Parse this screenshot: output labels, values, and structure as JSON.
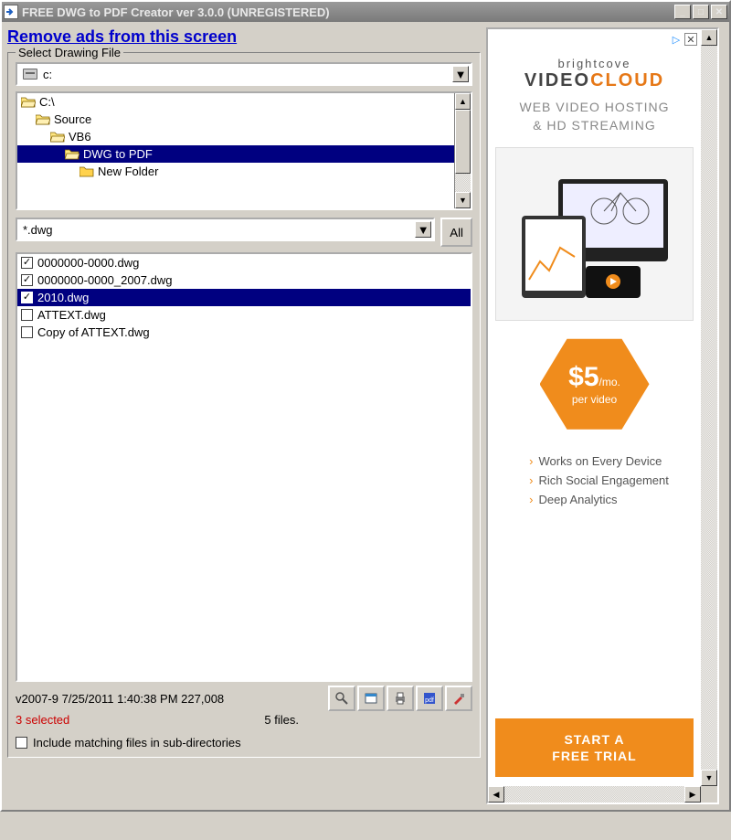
{
  "titlebar": {
    "title": "FREE DWG to PDF Creator ver 3.0.0 (UNREGISTERED)"
  },
  "ads_link": "Remove ads from this screen",
  "group": {
    "title": "Select Drawing File",
    "drive_combo": "c:",
    "tree": [
      {
        "label": "C:\\",
        "indent": 0,
        "open": true,
        "sel": false
      },
      {
        "label": "Source",
        "indent": 1,
        "open": true,
        "sel": false
      },
      {
        "label": "VB6",
        "indent": 2,
        "open": true,
        "sel": false
      },
      {
        "label": "DWG to PDF",
        "indent": 3,
        "open": true,
        "sel": true
      },
      {
        "label": "New Folder",
        "indent": 4,
        "open": false,
        "sel": false
      }
    ],
    "filter": "*.dwg",
    "all_btn": "All",
    "files": [
      {
        "name": "0000000-0000.dwg",
        "checked": true,
        "sel": false
      },
      {
        "name": "0000000-0000_2007.dwg",
        "checked": true,
        "sel": false
      },
      {
        "name": "2010.dwg",
        "checked": true,
        "sel": true
      },
      {
        "name": "ATTEXT.dwg",
        "checked": false,
        "sel": false
      },
      {
        "name": "Copy of ATTEXT.dwg",
        "checked": false,
        "sel": false
      }
    ],
    "status_line": "v2007-9  7/25/2011 1:40:38 PM  227,008",
    "selected_text": "3 selected",
    "file_count": "5 files.",
    "include_sub": "Include matching files in sub-directories"
  },
  "toolbar_icons": [
    "zoom-icon",
    "explorer-icon",
    "print-icon",
    "pdf-icon",
    "settings-icon"
  ],
  "ad": {
    "brand": "brightcove",
    "logo_a": "VIDEO",
    "logo_b": "CLOUD",
    "tagline1": "WEB VIDEO HOSTING",
    "tagline2": "& HD STREAMING",
    "price_big": "$5",
    "price_unit": "/mo.",
    "price_sub": "per video",
    "bullets": [
      "Works on Every Device",
      "Rich Social Engagement",
      "Deep Analytics"
    ],
    "cta1": "START A",
    "cta2": "FREE TRIAL"
  }
}
